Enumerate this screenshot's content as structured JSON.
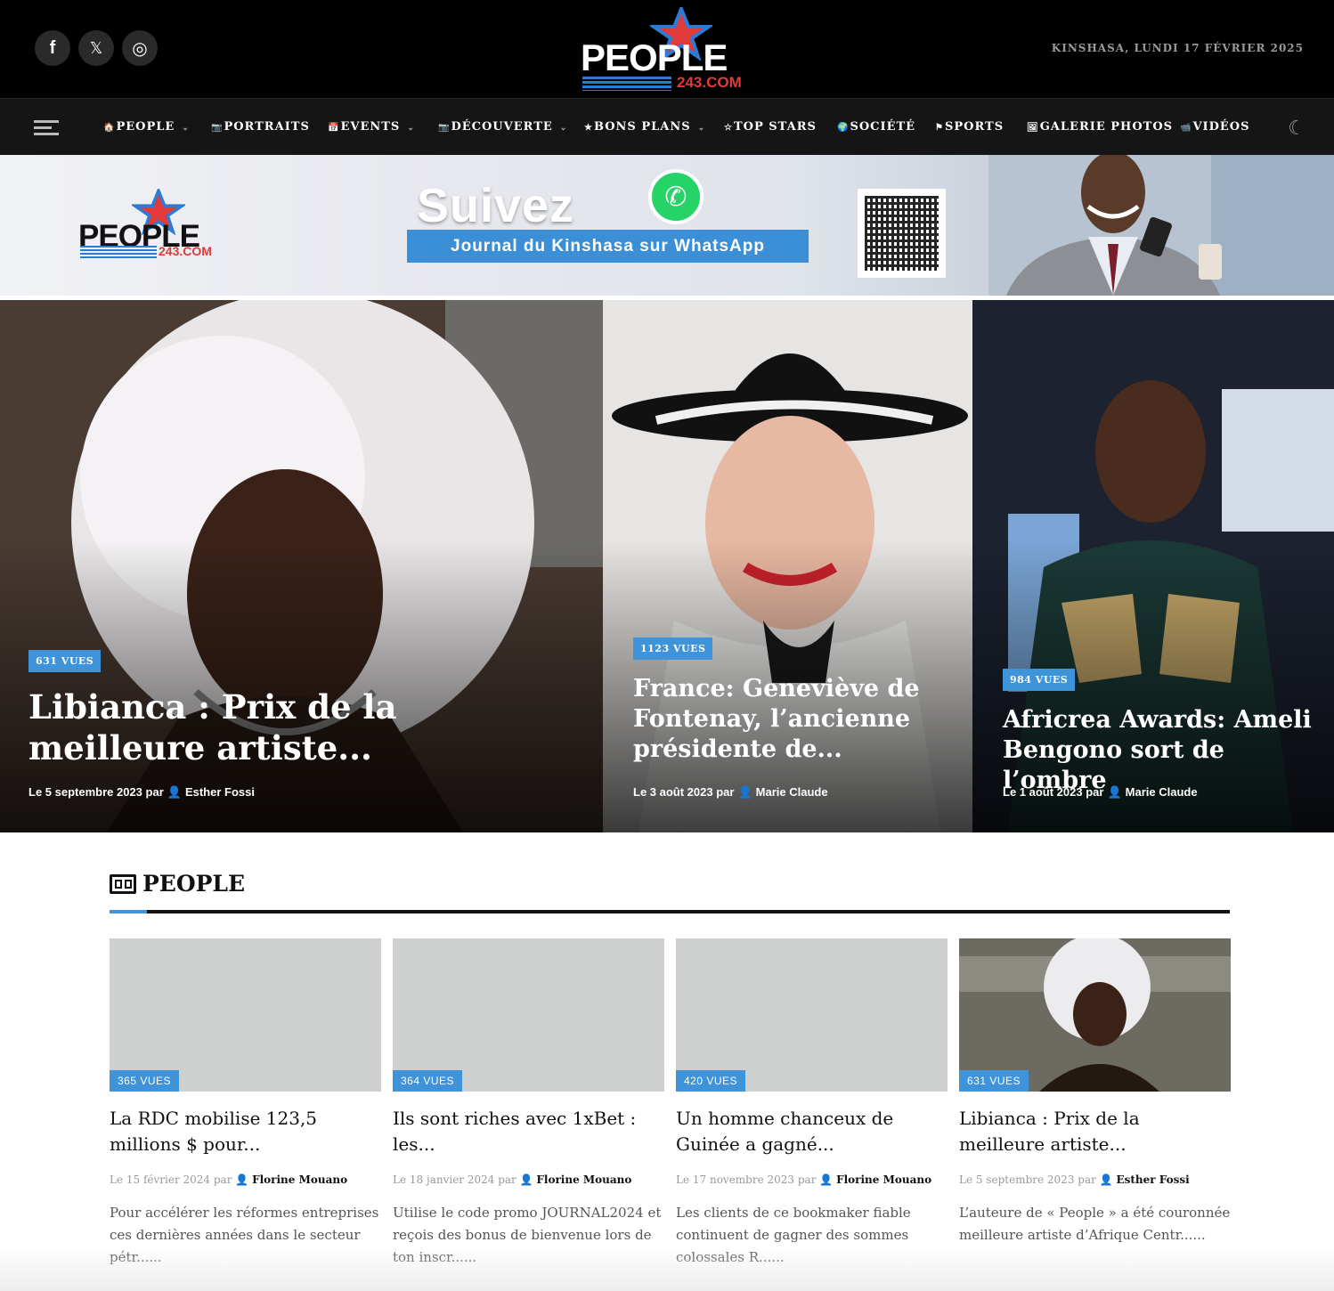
{
  "header": {
    "social": [
      {
        "name": "facebook-icon",
        "glyph": "f"
      },
      {
        "name": "x-icon",
        "glyph": "𝕏"
      },
      {
        "name": "instagram-icon",
        "glyph": "◎"
      }
    ],
    "logo_word": "PEOPLE",
    "logo_domain": "243.COM",
    "date": "KINSHASA, LUNDI 17 FÉVRIER 2025"
  },
  "nav": {
    "items": [
      {
        "label": "PEOPLE",
        "icon": "🏠",
        "dropdown": true
      },
      {
        "label": "PORTRAITS",
        "icon": "📷",
        "dropdown": false
      },
      {
        "label": "EVENTS",
        "icon": "📅",
        "dropdown": true
      },
      {
        "label": "DÉCOUVERTE",
        "icon": "📷",
        "dropdown": true
      },
      {
        "label": "BONS PLANS",
        "icon": "★",
        "dropdown": true
      },
      {
        "label": "TOP STARS",
        "icon": "☆",
        "dropdown": false
      },
      {
        "label": "SOCIÉTÉ",
        "icon": "🌍",
        "dropdown": false
      },
      {
        "label": "SPORTS",
        "icon": "⚑",
        "dropdown": false
      },
      {
        "label": "GALERIE PHOTOS",
        "icon": "🖼",
        "dropdown": false
      },
      {
        "label": "VIDÉOS",
        "icon": "📹",
        "dropdown": false
      }
    ],
    "chevron": "⌄",
    "dark_mode_icon": "☾"
  },
  "banner": {
    "logo_word": "PEOPLE",
    "logo_domain": "243.COM",
    "headline": "Suivez",
    "subline": "Journal du Kinshasa sur WhatsApp"
  },
  "hero": [
    {
      "views": "631 VUES",
      "title": "Libianca : Prix de la meilleure artiste...",
      "date": "Le 5 septembre 2023 par",
      "author": "Esther Fossi"
    },
    {
      "views": "1123 VUES",
      "title": "France: Geneviève de Fontenay, l’ancienne présidente de...",
      "date": "Le 3 août 2023 par",
      "author": "Marie Claude"
    },
    {
      "views": "984 VUES",
      "title": "Africrea Awards: Ameli Bengono sort de l’ombre",
      "date": "Le 1 août 2023 par",
      "author": "Marie Claude"
    }
  ],
  "section": {
    "title": "PEOPLE",
    "cards": [
      {
        "views": "365 VUES",
        "title": "La RDC mobilise 123,5 millions $ pour...",
        "date": "Le 15 février 2024 par",
        "author": "Florine Mouano",
        "excerpt": "Pour accélérer les réformes entreprises ces dernières années dans le secteur pétr......"
      },
      {
        "views": "364 VUES",
        "title": "Ils sont riches avec 1xBet : les...",
        "date": "Le 18 janvier 2024 par",
        "author": "Florine Mouano",
        "excerpt": "Utilise le code promo JOURNAL2024 et reçois des bonus de bienvenue lors de ton inscr......"
      },
      {
        "views": "420 VUES",
        "title": "Un homme chanceux de Guinée a gagné...",
        "date": "Le 17 novembre 2023 par",
        "author": "Florine Mouano",
        "excerpt": "Les clients de ce bookmaker fiable continuent de gagner des sommes colossales R......"
      },
      {
        "views": "631 VUES",
        "title": "Libianca : Prix de la meilleure artiste...",
        "date": "Le 5 septembre 2023 par",
        "author": "Esther Fossi",
        "excerpt": "L’auteure de « People » a été couronnée meilleure artiste d’Afrique Centr......"
      }
    ]
  },
  "colors": {
    "accent": "#3e93d9",
    "logo_red": "#e03a3a",
    "header_bg": "#000000",
    "nav_bg": "#151515"
  }
}
